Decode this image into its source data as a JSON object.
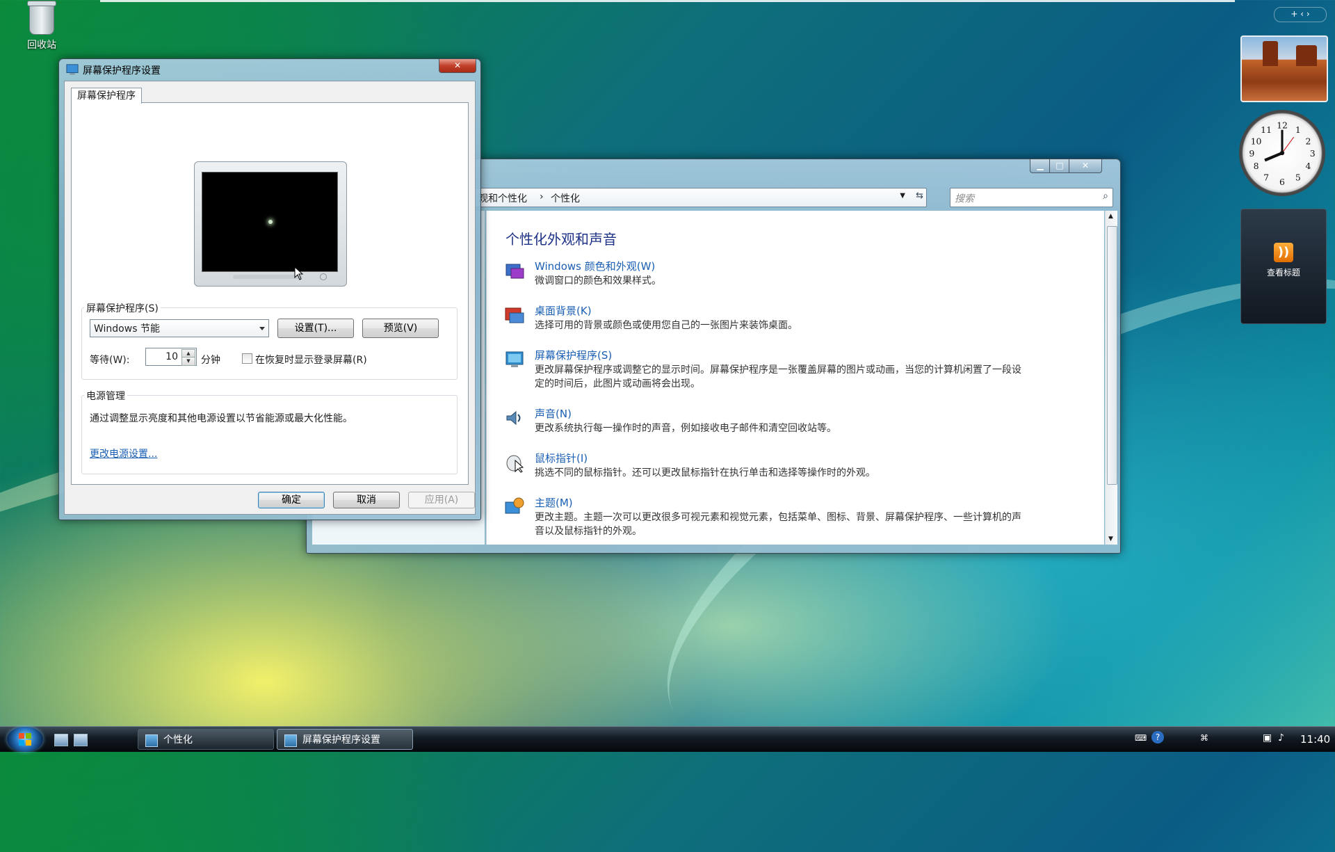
{
  "desktop": {
    "recycle_bin_label": "回收站"
  },
  "control_panel": {
    "breadcrumb_parent": "观和个性化",
    "breadcrumb_sep": "›",
    "breadcrumb_current": "个性化",
    "search_placeholder": "搜索",
    "heading": "个性化外观和声音",
    "items": [
      {
        "link": "Windows 颜色和外观(W)",
        "desc": "微调窗口的颜色和效果样式。",
        "icon": "color-appearance-icon"
      },
      {
        "link": "桌面背景(K)",
        "desc": "选择可用的背景或颜色或使用您自己的一张图片来装饰桌面。",
        "icon": "desktop-background-icon"
      },
      {
        "link": "屏幕保护程序(S)",
        "desc": "更改屏幕保护程序或调整它的显示时间。屏幕保护程序是一张覆盖屏幕的图片或动画，当您的计算机闲置了一段设定的时间后，此图片或动画将会出现。",
        "icon": "screensaver-icon"
      },
      {
        "link": "声音(N)",
        "desc": "更改系统执行每一操作时的声音，例如接收电子邮件和清空回收站等。",
        "icon": "sound-icon"
      },
      {
        "link": "鼠标指针(I)",
        "desc": "挑选不同的鼠标指针。还可以更改鼠标指针在执行单击和选择等操作时的外观。",
        "icon": "mouse-pointer-icon"
      },
      {
        "link": "主题(M)",
        "desc": "更改主题。主题一次可以更改很多可视元素和视觉元素，包括菜单、图标、背景、屏幕保护程序、一些计算机的声音以及鼠标指针的外观。",
        "icon": "theme-icon"
      }
    ]
  },
  "screensaver_dialog": {
    "title": "屏幕保护程序设置",
    "tab": "屏幕保护程序",
    "group_label": "屏幕保护程序(S)",
    "selected": "Windows 节能",
    "settings_button": "设置(T)...",
    "preview_button": "预览(V)",
    "wait_label": "等待(W):",
    "wait_value": "10",
    "wait_unit": "分钟",
    "resume_checkbox": "在恢复时显示登录屏幕(R)",
    "resume_checked": false,
    "power_group": "电源管理",
    "power_text": "通过调整显示亮度和其他电源设置以节省能源或最大化性能。",
    "power_link": "更改电源设置...",
    "ok_button": "确定",
    "cancel_button": "取消",
    "apply_button": "应用(A)"
  },
  "sidebar": {
    "rss_label": "查看标题"
  },
  "taskbar": {
    "tasks": [
      "个性化",
      "屏幕保护程序设置"
    ],
    "clock": "11:40"
  }
}
